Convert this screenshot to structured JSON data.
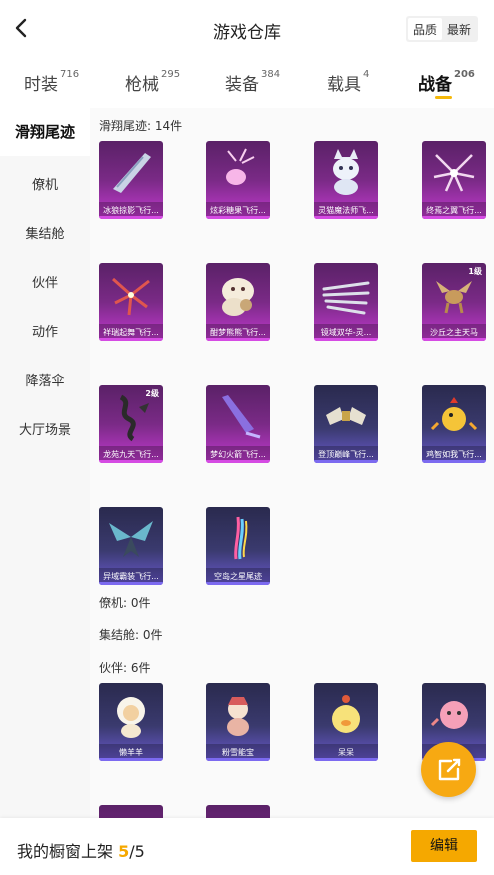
{
  "header": {
    "title": "游戏仓库",
    "sort": [
      "品质",
      "最新"
    ]
  },
  "tabs": [
    {
      "label": "时装",
      "count": "716"
    },
    {
      "label": "枪械",
      "count": "295"
    },
    {
      "label": "装备",
      "count": "384"
    },
    {
      "label": "载具",
      "count": "4"
    },
    {
      "label": "战备",
      "count": "206"
    }
  ],
  "sidebar": [
    "滑翔尾迹",
    "僚机",
    "集结舱",
    "伙伴",
    "动作",
    "降落伞",
    "大厅场景"
  ],
  "sections": {
    "trail": "滑翔尾迹: 14件",
    "wingman": "僚机: 0件",
    "pod": "集结舱: 0件",
    "partner": "伙伴: 6件"
  },
  "items": [
    {
      "label": "冰狼掠影飞行...",
      "level": ""
    },
    {
      "label": "炫彩糖果飞行...",
      "level": ""
    },
    {
      "label": "灵猫魔法师飞...",
      "level": ""
    },
    {
      "label": "终焉之翼飞行...",
      "level": ""
    },
    {
      "label": "祥瑞起舞飞行...",
      "level": ""
    },
    {
      "label": "酣梦熊熊飞行...",
      "level": ""
    },
    {
      "label": "镜域双华-灵...",
      "level": ""
    },
    {
      "label": "沙丘之主天马",
      "level": "1级"
    },
    {
      "label": "龙苑九天飞行...",
      "level": "2级"
    },
    {
      "label": "梦幻火箭飞行...",
      "level": ""
    },
    {
      "label": "登顶巅峰飞行...",
      "level": ""
    },
    {
      "label": "鸡智如我飞行...",
      "level": ""
    },
    {
      "label": "异域霸装飞行...",
      "level": ""
    },
    {
      "label": "空岛之星尾迹",
      "level": ""
    }
  ],
  "partners": [
    {
      "label": "懒羊羊"
    },
    {
      "label": "粉雪能宝"
    },
    {
      "label": "呆呆"
    },
    {
      "label": ""
    }
  ],
  "footer": {
    "text": "我的橱窗上架",
    "count": "5",
    "total": "/5",
    "edit": "编辑"
  },
  "colors": {
    "accent": "#f5a800",
    "purple_card": "#7a2a86",
    "blue_card": "#3a3a6e"
  },
  "icons": {
    "back": "chevron-left-icon",
    "share": "share-external-icon"
  }
}
